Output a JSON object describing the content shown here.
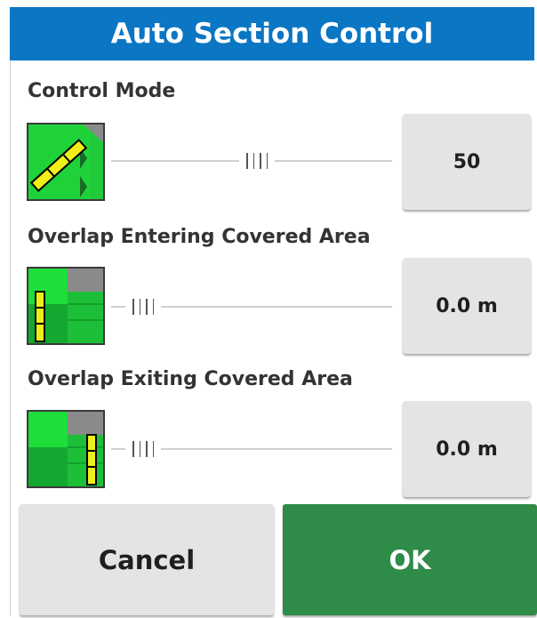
{
  "dialog": {
    "title": "Auto Section Control"
  },
  "settings": [
    {
      "label": "Control Mode",
      "icon": "control-mode-icon",
      "value": "50",
      "slider_fraction": 0.52
    },
    {
      "label": "Overlap Entering Covered Area",
      "icon": "overlap-entering-icon",
      "value": "0.0 m",
      "slider_fraction": 0.11
    },
    {
      "label": "Overlap Exiting Covered Area",
      "icon": "overlap-exiting-icon",
      "value": "0.0 m",
      "slider_fraction": 0.11
    }
  ],
  "buttons": {
    "cancel": "Cancel",
    "ok": "OK"
  },
  "colors": {
    "title_bar": "#0a76c4",
    "ok_button": "#2e8b48",
    "field_green": "#22c93a",
    "implement_yellow": "#e6e619"
  }
}
